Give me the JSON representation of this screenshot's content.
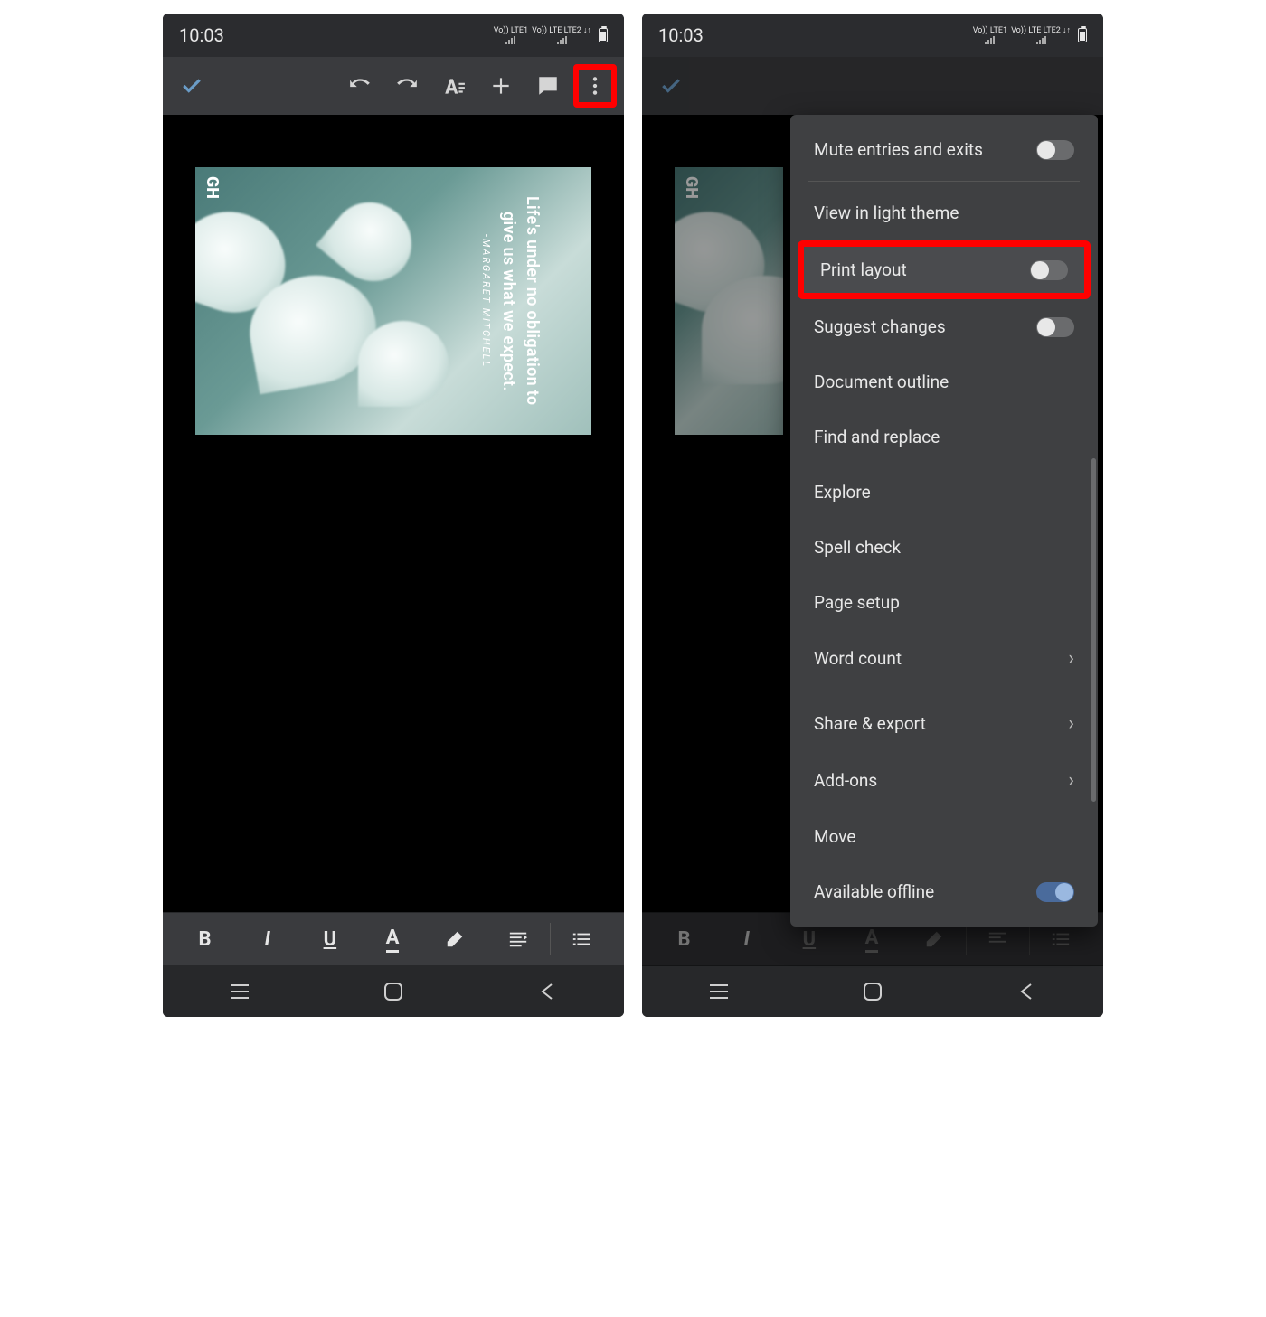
{
  "status": {
    "time": "10:03",
    "lte1": "Vo)) LTE1",
    "lte2": "Vo)) LTE LTE2 ↓↑"
  },
  "document": {
    "quote": "Life's under no obligation to give us what we expect.",
    "author": "-MARGARET MITCHELL",
    "watermark": "GH"
  },
  "format_labels": {
    "bold": "B",
    "italic": "I",
    "underline": "U",
    "text_color": "A"
  },
  "menu": {
    "mute": "Mute entries and exits",
    "light_theme": "View in light theme",
    "print_layout": "Print layout",
    "suggest": "Suggest changes",
    "outline": "Document outline",
    "find": "Find and replace",
    "explore": "Explore",
    "spell": "Spell check",
    "page_setup": "Page setup",
    "word_count": "Word count",
    "share": "Share & export",
    "addons": "Add-ons",
    "move": "Move",
    "offline": "Available offline"
  }
}
